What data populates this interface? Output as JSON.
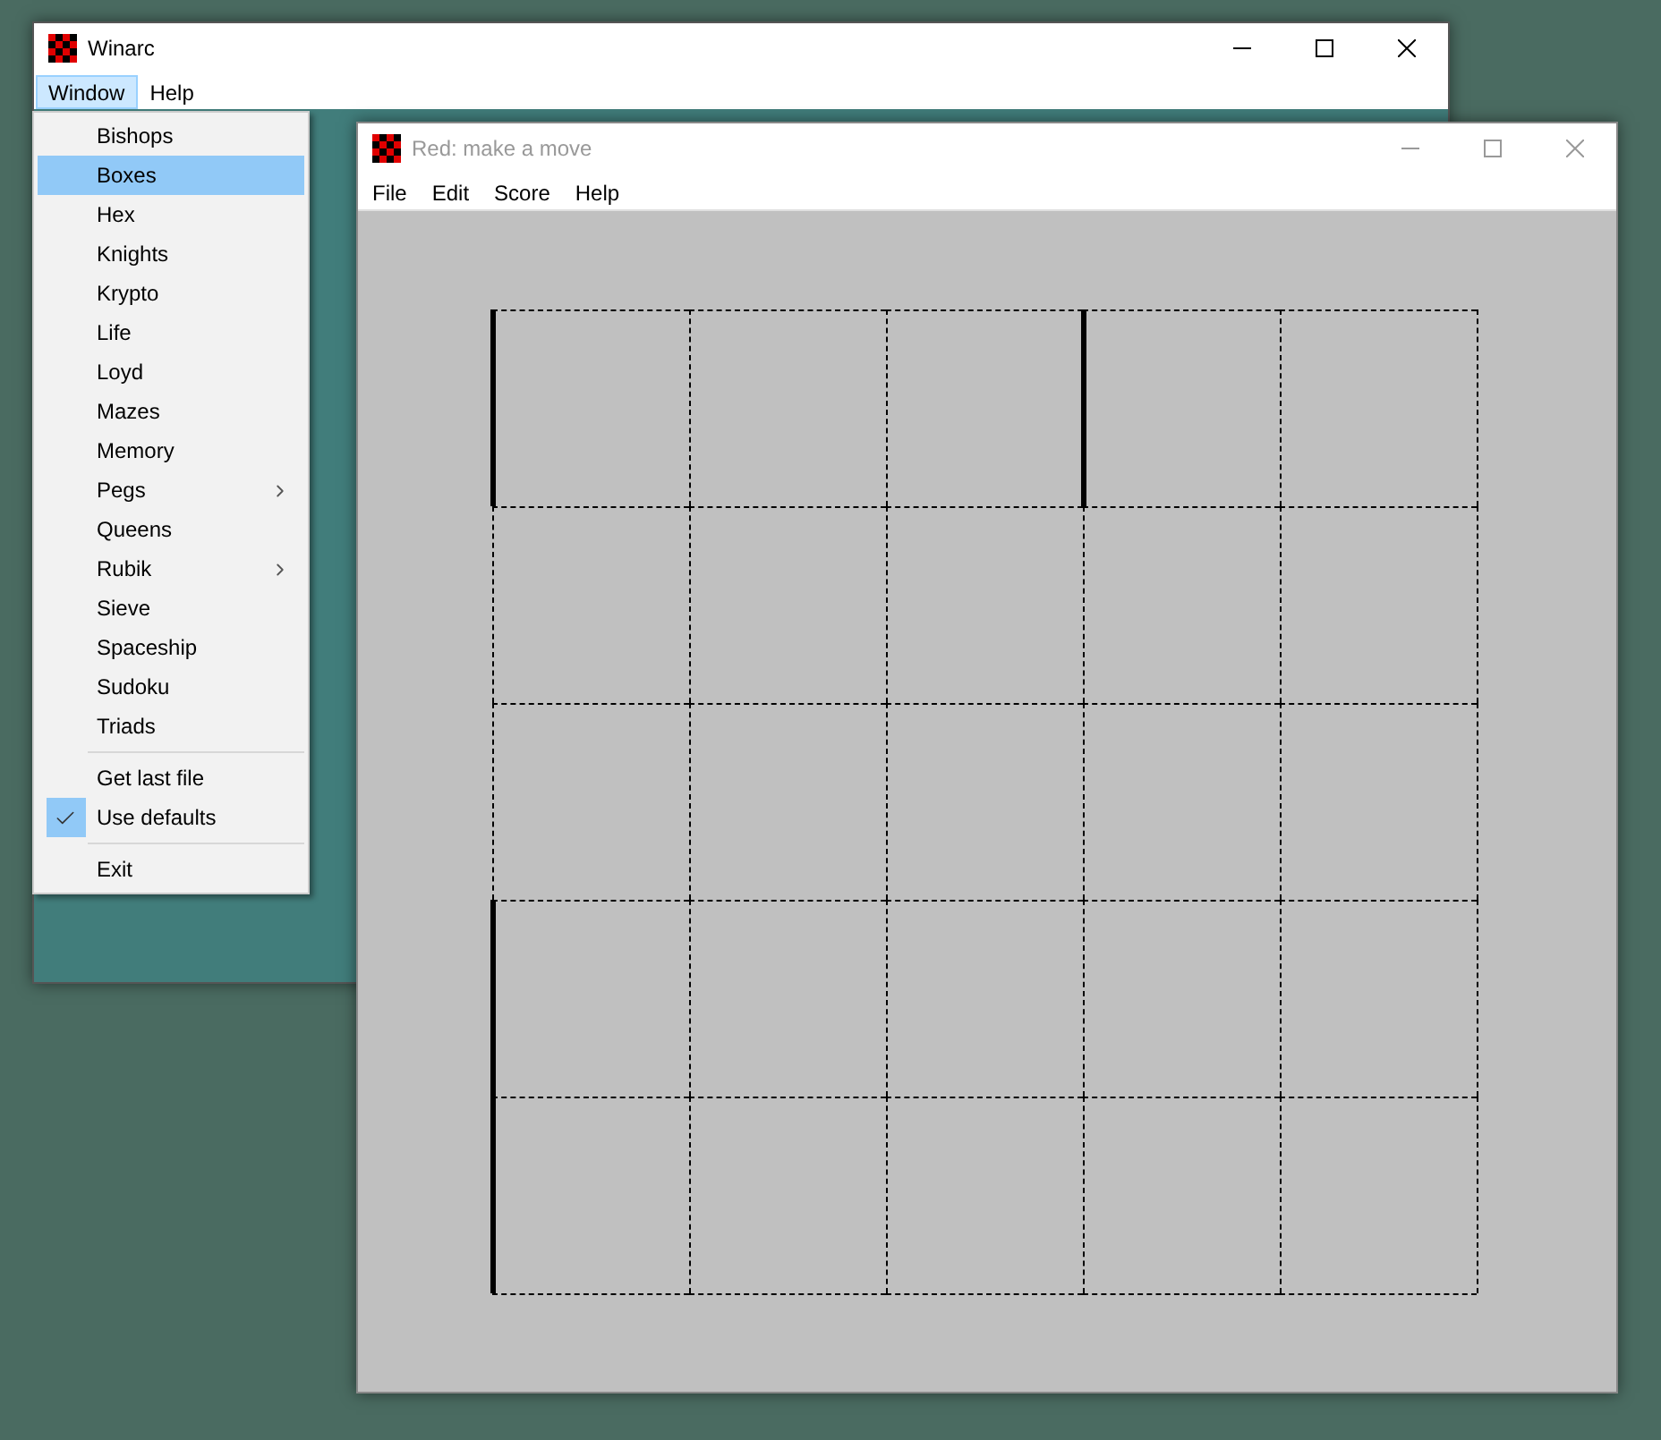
{
  "main_window": {
    "title": "Winarc",
    "active": true,
    "menu_bar": [
      {
        "label": "Window",
        "selected": true
      },
      {
        "label": "Help",
        "selected": false
      }
    ],
    "dropdown": [
      {
        "kind": "item",
        "label": "Bishops",
        "selected": false
      },
      {
        "kind": "item",
        "label": "Boxes",
        "selected": true
      },
      {
        "kind": "item",
        "label": "Hex",
        "selected": false
      },
      {
        "kind": "item",
        "label": "Knights",
        "selected": false
      },
      {
        "kind": "item",
        "label": "Krypto",
        "selected": false
      },
      {
        "kind": "item",
        "label": "Life",
        "selected": false
      },
      {
        "kind": "item",
        "label": "Loyd",
        "selected": false
      },
      {
        "kind": "item",
        "label": "Mazes",
        "selected": false
      },
      {
        "kind": "item",
        "label": "Memory",
        "selected": false
      },
      {
        "kind": "submenu",
        "label": "Pegs",
        "selected": false
      },
      {
        "kind": "item",
        "label": "Queens",
        "selected": false
      },
      {
        "kind": "submenu",
        "label": "Rubik",
        "selected": false
      },
      {
        "kind": "item",
        "label": "Sieve",
        "selected": false
      },
      {
        "kind": "item",
        "label": "Spaceship",
        "selected": false
      },
      {
        "kind": "item",
        "label": "Sudoku",
        "selected": false
      },
      {
        "kind": "item",
        "label": "Triads",
        "selected": false
      },
      {
        "kind": "separator"
      },
      {
        "kind": "check",
        "label": "Get last file",
        "selected": false,
        "checked": false
      },
      {
        "kind": "check",
        "label": "Use defaults",
        "selected": false,
        "checked": true
      },
      {
        "kind": "separator"
      },
      {
        "kind": "item",
        "label": "Exit",
        "selected": false
      }
    ]
  },
  "game_window": {
    "title": "Red: make a move",
    "active": false,
    "menu_bar": [
      {
        "label": "File",
        "selected": false
      },
      {
        "label": "Edit",
        "selected": false
      },
      {
        "label": "Score",
        "selected": false
      },
      {
        "label": "Help",
        "selected": false
      }
    ],
    "board": {
      "vertical_edges": [
        [
          true,
          false,
          false,
          true,
          false,
          false
        ],
        [
          false,
          false,
          false,
          false,
          false,
          false
        ],
        [
          false,
          false,
          false,
          false,
          false,
          false
        ],
        [
          true,
          false,
          false,
          false,
          false,
          false
        ],
        [
          true,
          false,
          false,
          false,
          false,
          false
        ]
      ],
      "horizontal_edges": [
        [
          false,
          false,
          false,
          false,
          false
        ],
        [
          false,
          false,
          false,
          false,
          false
        ],
        [
          false,
          false,
          false,
          false,
          false
        ],
        [
          false,
          false,
          false,
          false,
          false
        ],
        [
          false,
          false,
          false,
          false,
          false
        ],
        [
          false,
          false,
          false,
          false,
          false
        ]
      ]
    }
  }
}
